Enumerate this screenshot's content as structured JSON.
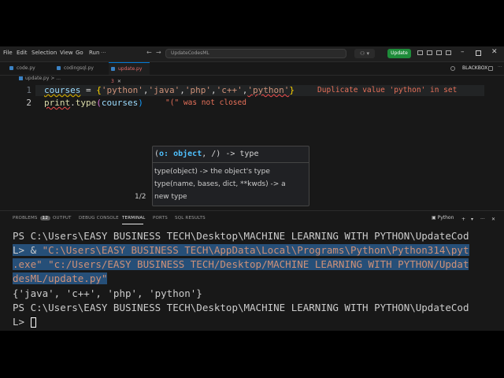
{
  "menubar": {
    "items": [
      "File",
      "Edit",
      "Selection",
      "View",
      "Go",
      "Run"
    ],
    "search_text": "UpdateCodesML",
    "update_label": "Update"
  },
  "tabs": [
    {
      "label": "code.py",
      "active": false
    },
    {
      "label": "codingsql.py",
      "active": false
    },
    {
      "label": "update.py",
      "suffix": "3",
      "active": true
    }
  ],
  "blackbox_label": "BLACKBOX",
  "breadcrumb": {
    "file": "update.py",
    "sep": ">",
    "rest": "..."
  },
  "editor": {
    "line_numbers": [
      "1",
      "2"
    ],
    "line1": {
      "var": "courses",
      "eq": " = ",
      "open": "{",
      "s1": "'python'",
      "c1": ",",
      "s2": "'java'",
      "c2": ",",
      "s3": "'php'",
      "c3": ",",
      "s4": "'c++'",
      "c4": ",",
      "s5": "'python'",
      "close": "}",
      "diagnostic": "Duplicate value 'python' in set"
    },
    "line2": {
      "fn1": "print",
      "dot": ".",
      "fn2": "type",
      "open": "(",
      "arg": "courses",
      "close": ")",
      "diagnostic": "\"(\" was not closed"
    }
  },
  "signature_help": {
    "signature_prefix": "(",
    "signature_param": "o: object",
    "signature_suffix": ", /) -> type",
    "doc_line1": "type(object) -> the object's type",
    "doc_line2": "type(name, bases, dict, **kwds) -> a",
    "doc_line3": "new type",
    "page": "1/2"
  },
  "panel": {
    "tabs": [
      "PROBLEMS",
      "OUTPUT",
      "DEBUG CONSOLE",
      "TERMINAL",
      "PORTS",
      "SQL RESULTS"
    ],
    "problems_count": "12",
    "active_tab": "TERMINAL",
    "terminal_name": "Python"
  },
  "terminal": {
    "lines": [
      "PS C:\\Users\\EASY BUSINESS TECH\\Desktop\\MACHINE LEARNING WITH PYTHON\\UpdateCod",
      "\"C:\\Users\\EASY BUSINESS TECH\\AppData\\Local\\Programs\\Python\\Python314\\pyt",
      ".exe\" \"c:/Users/EASY BUSINESS TECH/Desktop/MACHINE LEARNING WITH PYTHON/Updat",
      "desML/update.py\"",
      "{'java', 'c++', 'php', 'python'}",
      "PS C:\\Users\\EASY BUSINESS TECH\\Desktop\\MACHINE LEARNING WITH PYTHON\\UpdateCod"
    ],
    "line2_prefix": "L> & ",
    "prompt_tail": "L> "
  },
  "colors": {
    "accent": "#0078d4",
    "update_button": "#1e8c3a",
    "error": "#e8715a",
    "selection": "#264f78"
  }
}
